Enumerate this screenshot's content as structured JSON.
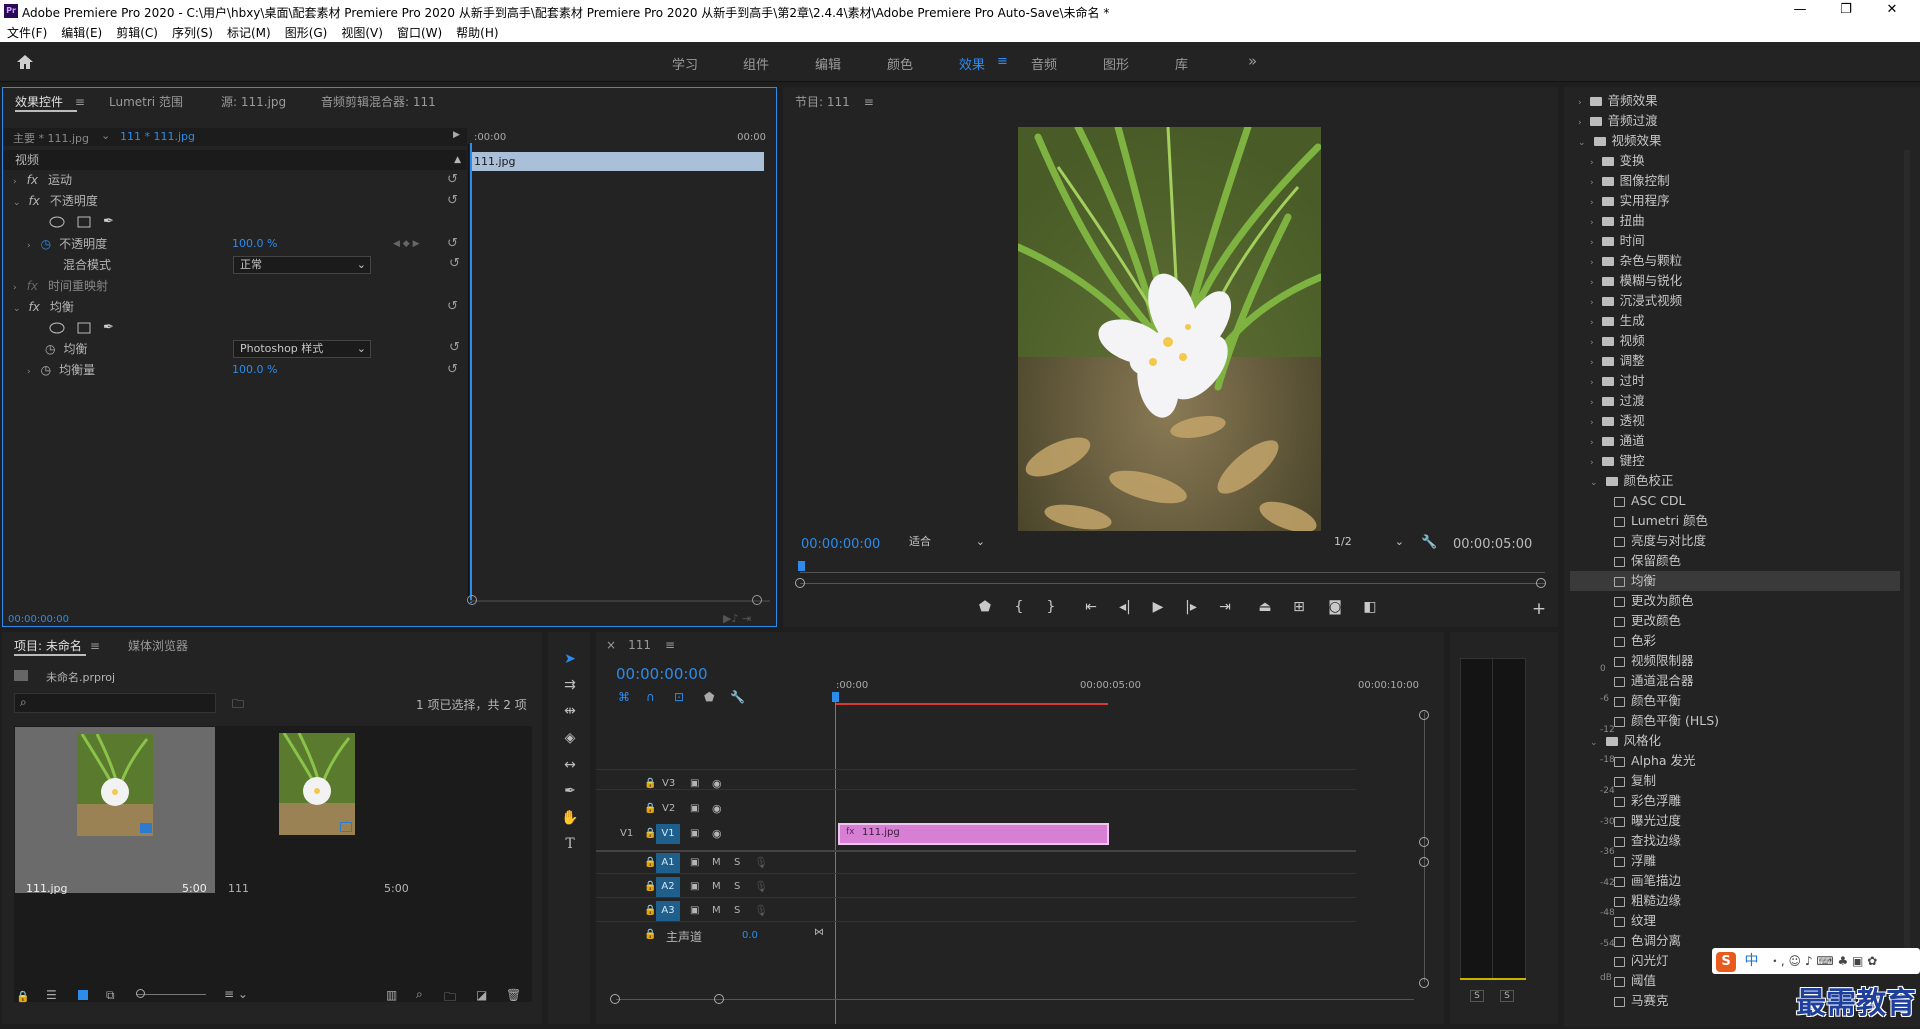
{
  "window": {
    "title": "Adobe Premiere Pro 2020 - C:\\用户\\hbxy\\桌面\\配套素材 Premiere Pro 2020 从新手到高手\\配套素材 Premiere Pro 2020 从新手到高手\\第2章\\2.4.4\\素材\\Adobe Premiere Pro Auto-Save\\未命名 *",
    "logo": "Pr",
    "minimize": "—",
    "maximize": "❐",
    "close": "✕"
  },
  "menu": [
    "文件(F)",
    "编辑(E)",
    "剪辑(C)",
    "序列(S)",
    "标记(M)",
    "图形(G)",
    "视图(V)",
    "窗口(W)",
    "帮助(H)"
  ],
  "workspaces": {
    "items": [
      "学习",
      "组件",
      "编辑",
      "颜色",
      "效果",
      "音频",
      "图形",
      "库"
    ],
    "active": "效果",
    "more": "»"
  },
  "effect_controls": {
    "tabs": [
      "效果控件",
      "Lumetri 范围",
      "源: 111.jpg",
      "音频剪辑混合器: 111"
    ],
    "master": "主要 * 111.jpg",
    "clip": "111 * 111.jpg",
    "ruler_start": ":00:00",
    "ruler_end": "00:00",
    "clip_bar": "111.jpg",
    "section_video": "视频",
    "motion": "运动",
    "opacity": "不透明度",
    "opacity_param": "不透明度",
    "opacity_value": "100.0 %",
    "blend_label": "混合模式",
    "blend_value": "正常",
    "time_remap": "时间重映射",
    "equalize": "均衡",
    "equalize_param": "均衡",
    "equalize_value": "Photoshop 样式",
    "equalize_amount": "均衡量",
    "equalize_amount_value": "100.0 %",
    "timecode": "00:00:00:00",
    "fx": "fx"
  },
  "program": {
    "title": "节目: 111",
    "timecode": "00:00:00:00",
    "fit": "适合",
    "resolution": "1/2",
    "duration": "00:00:05:00"
  },
  "effects_panel": {
    "top_folders": [
      "音频效果",
      "音频过渡",
      "视频效果"
    ],
    "video_folders": [
      "变换",
      "图像控制",
      "实用程序",
      "扭曲",
      "时间",
      "杂色与颗粒",
      "模糊与锐化",
      "沉浸式视频",
      "生成",
      "视频",
      "调整",
      "过时",
      "过渡",
      "透视",
      "通道",
      "键控",
      "颜色校正"
    ],
    "color_correction": [
      "ASC CDL",
      "Lumetri 颜色",
      "亮度与对比度",
      "保留颜色",
      "均衡",
      "更改为颜色",
      "更改颜色",
      "色彩",
      "视频限制器",
      "通道混合器",
      "颜色平衡",
      "颜色平衡 (HLS)"
    ],
    "stylize_folder": "风格化",
    "stylize": [
      "Alpha 发光",
      "复制",
      "彩色浮雕",
      "曝光过度",
      "查找边缘",
      "浮雕",
      "画笔描边",
      "粗糙边缘",
      "纹理",
      "色调分离",
      "闪光灯",
      "阈值",
      "马赛克"
    ],
    "selected": "均衡"
  },
  "project": {
    "tabs": [
      "项目: 未命名",
      "媒体浏览器"
    ],
    "file": "未命名.prproj",
    "status": "1 项已选择，共 2 项",
    "items": [
      {
        "name": "111.jpg",
        "duration": "5:00"
      },
      {
        "name": "111",
        "duration": "5:00"
      }
    ]
  },
  "timeline": {
    "title": "111",
    "timecode": "00:00:00:00",
    "ruler": [
      ":00:00",
      "00:00:05:00",
      "00:00:10:00"
    ],
    "video_tracks": [
      "V3",
      "V2",
      "V1"
    ],
    "audio_tracks": [
      "A1",
      "A2",
      "A3"
    ],
    "source_v": "V1",
    "clip": "111.jpg",
    "master": "主声道",
    "master_value": "0.0",
    "m": "M",
    "s": "S"
  },
  "meter": {
    "labels": [
      "0",
      "-6",
      "-12",
      "-18",
      "-24",
      "-30",
      "-36",
      "-42",
      "-48",
      "-54",
      "dB"
    ],
    "solo": [
      "S",
      "S"
    ]
  },
  "watermark": "最需教育",
  "ime": "中"
}
